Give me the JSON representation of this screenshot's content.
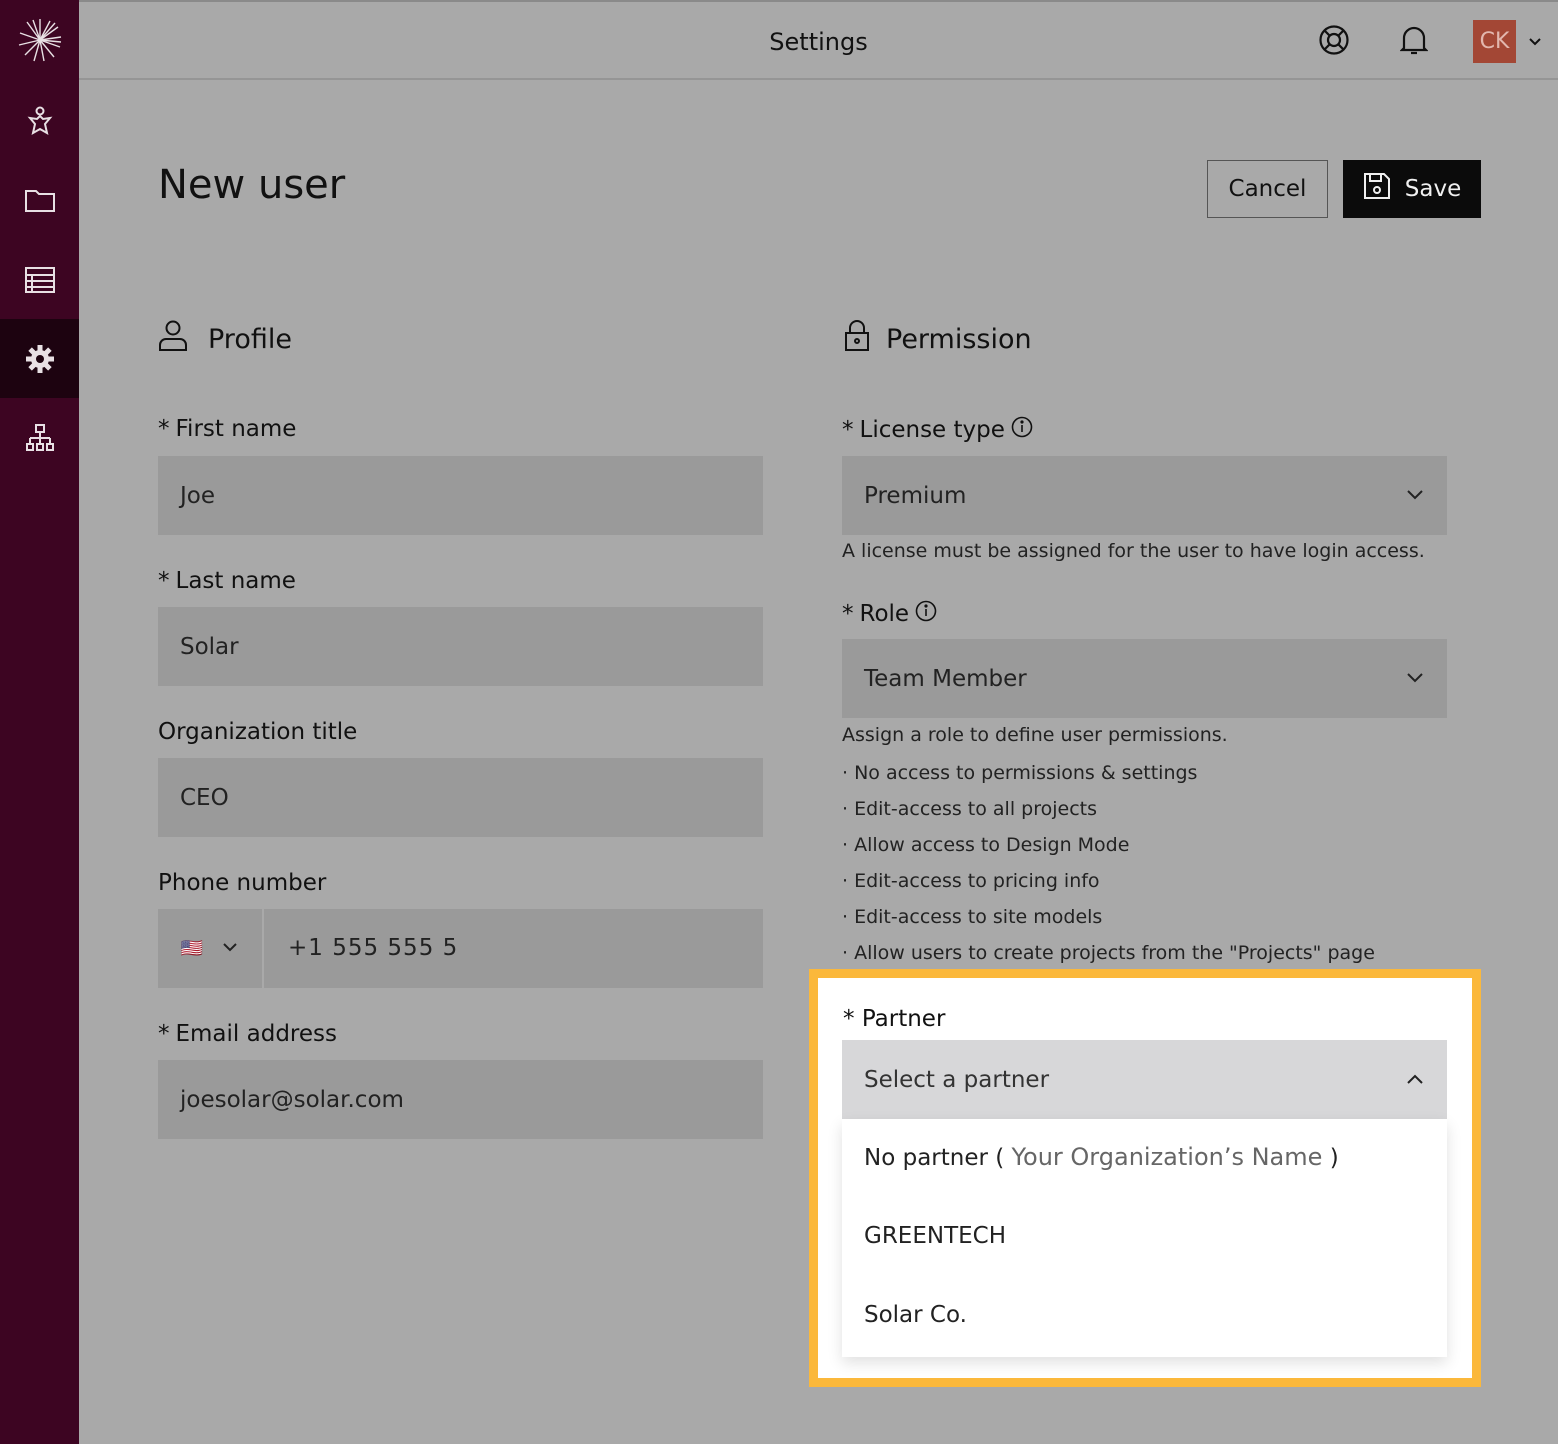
{
  "header": {
    "title": "Settings",
    "avatar_initials": "CK",
    "avatar_color": "#a34735"
  },
  "sidebar": {
    "items": [
      {
        "name": "logo",
        "icon": "sunburst-logo-icon"
      },
      {
        "name": "users",
        "icon": "person-star-icon"
      },
      {
        "name": "projects",
        "icon": "folder-icon"
      },
      {
        "name": "list",
        "icon": "table-list-icon"
      },
      {
        "name": "settings",
        "icon": "gear-icon",
        "active": true
      },
      {
        "name": "org",
        "icon": "org-chart-icon"
      }
    ]
  },
  "page": {
    "title": "New user",
    "cancel_label": "Cancel",
    "save_label": "Save"
  },
  "profile": {
    "heading": "Profile",
    "first_name": {
      "label": "First name",
      "required": "*",
      "value": "Joe"
    },
    "last_name": {
      "label": "Last name",
      "required": "*",
      "value": "Solar"
    },
    "org_title": {
      "label": "Organization title",
      "value": "CEO"
    },
    "phone": {
      "label": "Phone number",
      "country_flag": "🇺🇸",
      "value": "+1 555 555 5"
    },
    "email": {
      "label": "Email address",
      "required": "*",
      "value": "joesolar@solar.com"
    }
  },
  "permission": {
    "heading": "Permission",
    "license": {
      "label": "License type",
      "required": "*",
      "value": "Premium",
      "help": "A license must be assigned for the user to have login access."
    },
    "role": {
      "label": "Role",
      "required": "*",
      "value": "Team Member",
      "help": "Assign a role to define user permissions.",
      "bullets": [
        "· No access to permissions & settings",
        "· Edit-access to all projects",
        "· Allow access to Design Mode",
        "· Edit-access to pricing info",
        "· Edit-access to site models",
        "· Allow users to create projects from the \"Projects\" page"
      ]
    },
    "partner": {
      "label": "Partner",
      "required": "*",
      "placeholder": "Select a partner",
      "highlight_color": "#fbb83b",
      "options": [
        {
          "prefix": "No partner ( ",
          "name": "Your Organization’s Name",
          "suffix": " )"
        },
        {
          "label": "GREENTECH"
        },
        {
          "label": "Solar Co."
        }
      ]
    }
  }
}
